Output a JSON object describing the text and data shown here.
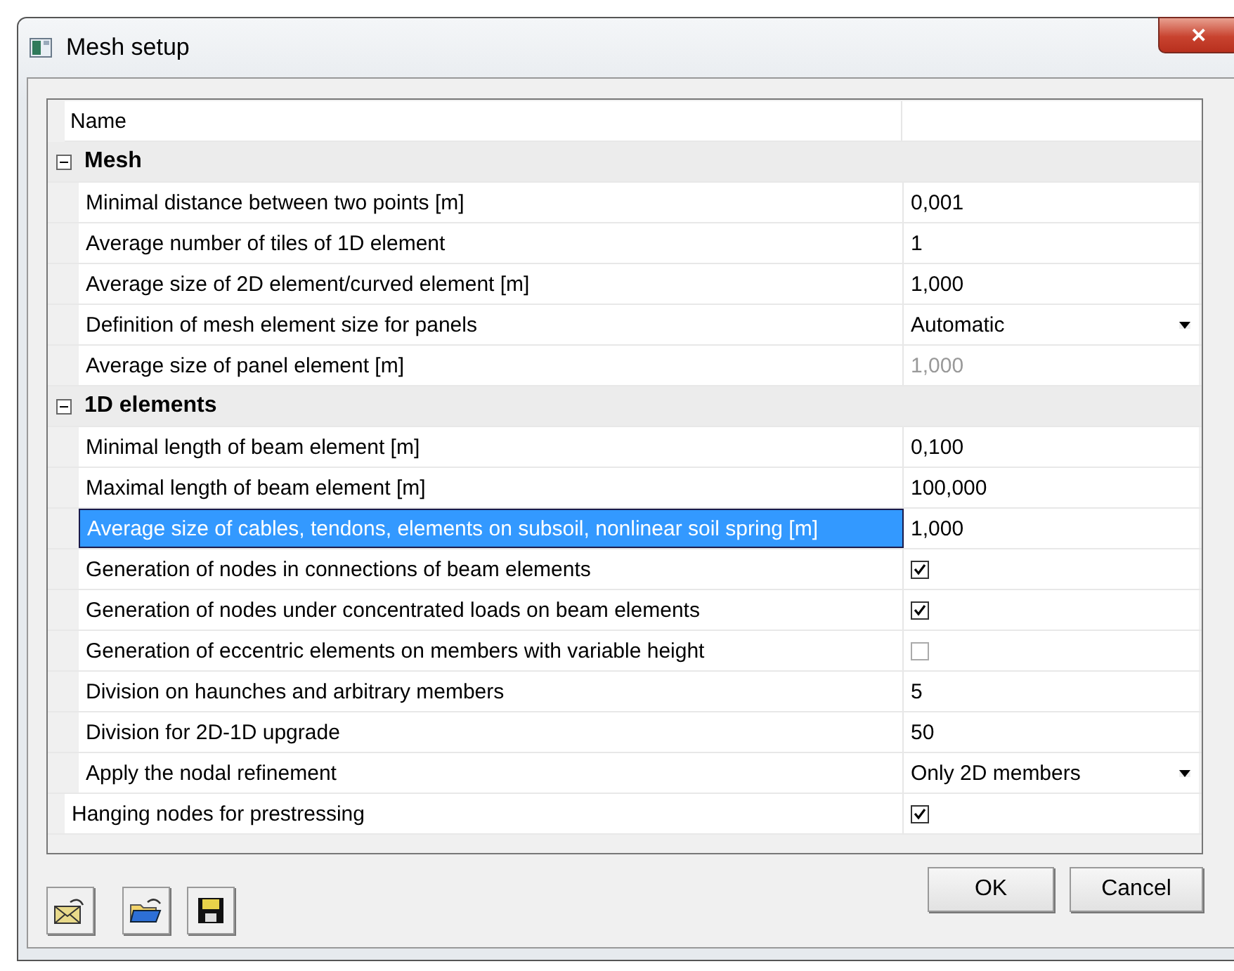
{
  "window": {
    "title": "Mesh setup",
    "close": "✕"
  },
  "grid": {
    "header": "Name",
    "items": [
      {
        "kind": "section",
        "label": "Mesh",
        "expanded": true,
        "children": [
          {
            "kind": "text",
            "label": "Minimal distance between two points [m]",
            "value": "0,001",
            "disabled": false,
            "selected": false
          },
          {
            "kind": "text",
            "label": "Average number of tiles of 1D element",
            "value": "1",
            "disabled": false,
            "selected": false
          },
          {
            "kind": "text",
            "label": "Average size of 2D element/curved element [m]",
            "value": "1,000",
            "disabled": false,
            "selected": false
          },
          {
            "kind": "dropdown",
            "label": "Definition of mesh element size for panels",
            "value": "Automatic",
            "disabled": false,
            "selected": false
          },
          {
            "kind": "text",
            "label": "Average size of panel element [m]",
            "value": "1,000",
            "disabled": true,
            "selected": false
          }
        ]
      },
      {
        "kind": "section",
        "label": "1D elements",
        "expanded": true,
        "children": [
          {
            "kind": "text",
            "label": "Minimal length of beam element [m]",
            "value": "0,100",
            "disabled": false,
            "selected": false
          },
          {
            "kind": "text",
            "label": "Maximal length of beam element [m]",
            "value": "100,000",
            "disabled": false,
            "selected": false
          },
          {
            "kind": "text",
            "label": "Average size of cables, tendons, elements on subsoil, nonlinear soil spring [m]",
            "value": "1,000",
            "disabled": false,
            "selected": true
          },
          {
            "kind": "checkbox",
            "label": "Generation of nodes in connections of beam elements",
            "checked": true,
            "disabled": false,
            "selected": false
          },
          {
            "kind": "checkbox",
            "label": "Generation of nodes under concentrated loads on beam elements",
            "checked": true,
            "disabled": false,
            "selected": false
          },
          {
            "kind": "checkbox",
            "label": "Generation of eccentric elements on members with variable height",
            "checked": false,
            "disabled": false,
            "selected": false
          },
          {
            "kind": "text",
            "label": "Division on haunches and arbitrary members",
            "value": "5",
            "disabled": false,
            "selected": false
          },
          {
            "kind": "text",
            "label": "Division for 2D-1D upgrade",
            "value": "50",
            "disabled": false,
            "selected": false
          },
          {
            "kind": "dropdown",
            "label": "Apply the nodal refinement",
            "value": "Only 2D members",
            "disabled": false,
            "selected": false
          }
        ]
      },
      {
        "kind": "checkbox",
        "label": "Hanging nodes for prestressing",
        "checked": true,
        "disabled": false,
        "selected": false
      }
    ]
  },
  "buttons": [
    "OK",
    "Cancel"
  ]
}
